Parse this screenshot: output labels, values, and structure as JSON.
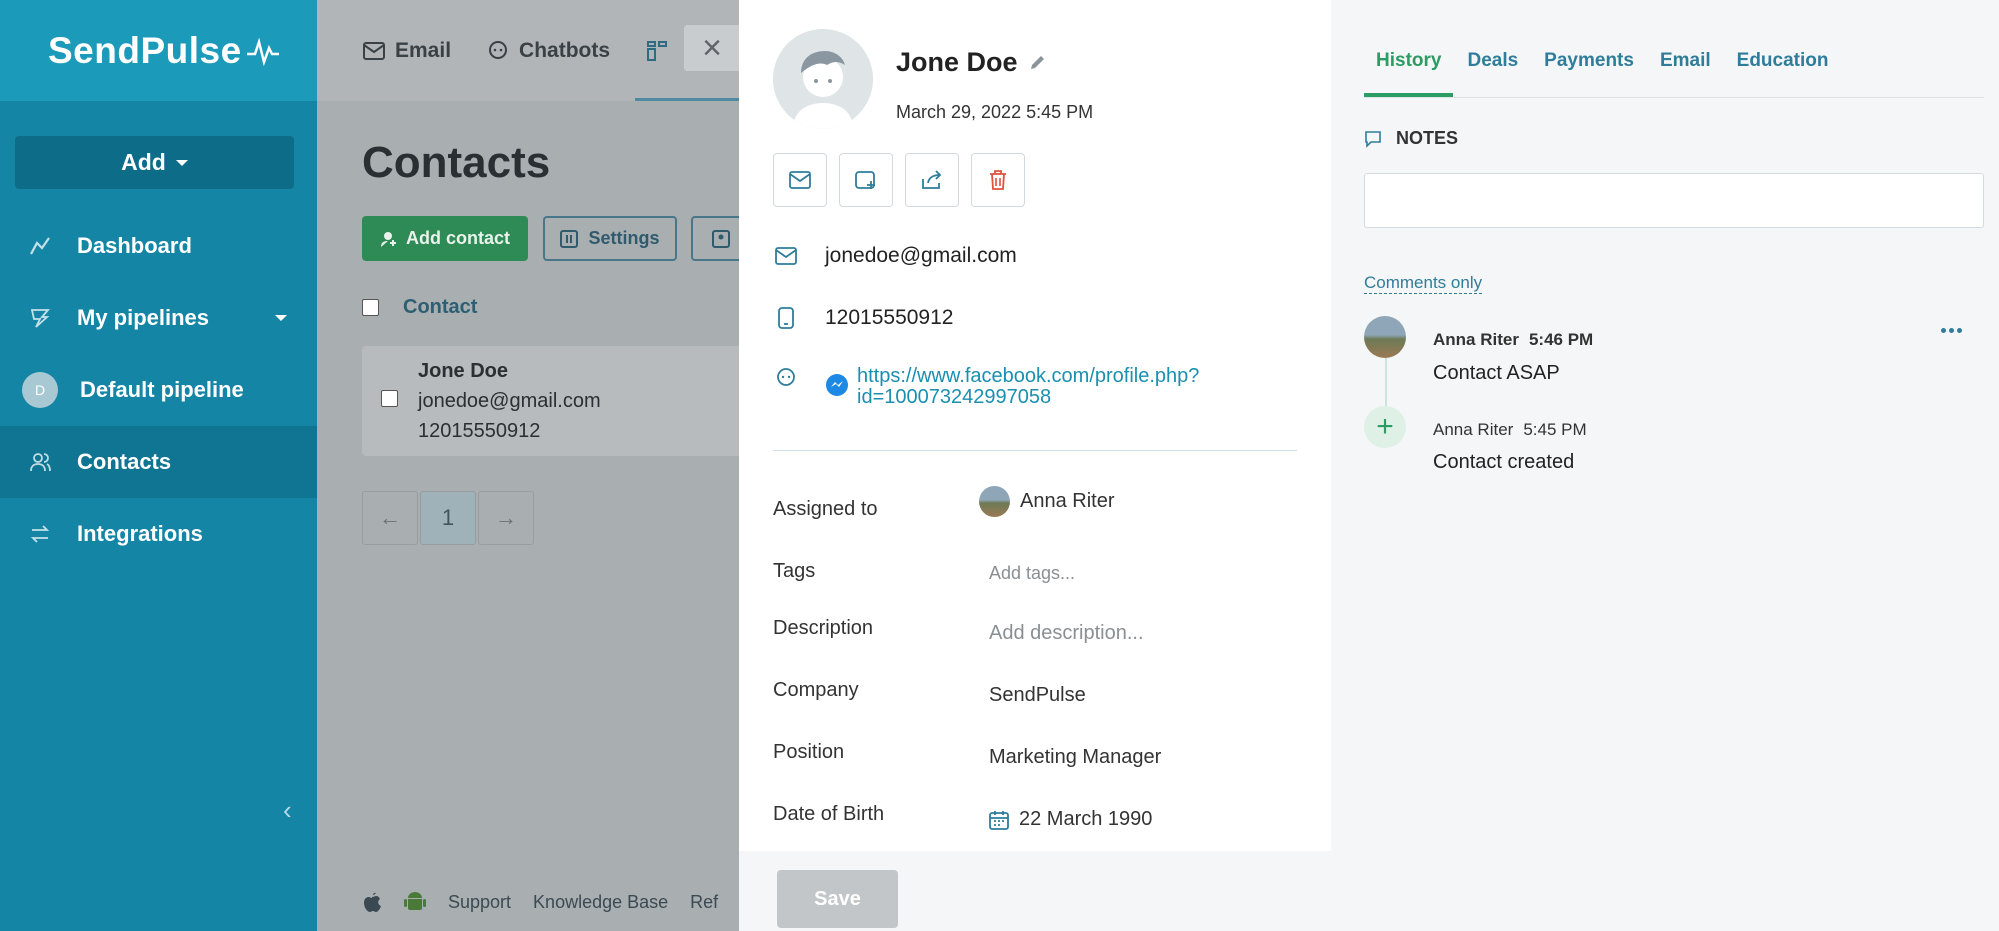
{
  "app": {
    "logo": "SendPulse"
  },
  "sidebar": {
    "add_label": "Add",
    "items": [
      {
        "label": "Dashboard",
        "icon": "chart-line-icon"
      },
      {
        "label": "My pipelines",
        "icon": "filter-icon"
      },
      {
        "label": "Default pipeline",
        "icon": "pipeline-avatar",
        "avatar_letter": "D"
      },
      {
        "label": "Contacts",
        "icon": "contacts-icon",
        "active": true
      },
      {
        "label": "Integrations",
        "icon": "integrations-icon"
      }
    ]
  },
  "topbar": {
    "items": [
      {
        "label": "Email",
        "icon": "envelope-icon"
      },
      {
        "label": "Chatbots",
        "icon": "chat-icon"
      }
    ]
  },
  "contacts_page": {
    "title": "Contacts",
    "add_contact_label": "Add contact",
    "settings_label": "Settings",
    "column_contact": "Contact",
    "row": {
      "name": "Jone Doe",
      "email": "jonedoe@gmail.com",
      "phone": "12015550912"
    },
    "pager": {
      "prev": "←",
      "page": "1",
      "next": "→"
    },
    "footer": {
      "support": "Support",
      "knowledge_base": "Knowledge Base",
      "ref": "Ref"
    }
  },
  "contact": {
    "name": "Jone Doe",
    "created": "March 29, 2022 5:45 PM",
    "email": "jonedoe@gmail.com",
    "phone": "12015550912",
    "messenger_url_line1": "https://www.facebook.com/profile.php?",
    "messenger_url_line2": "id=100073242997058",
    "fields": {
      "assigned_to_label": "Assigned to",
      "assigned_to_value": "Anna Riter",
      "tags_label": "Tags",
      "tags_placeholder": "Add tags...",
      "description_label": "Description",
      "description_placeholder": "Add description...",
      "company_label": "Company",
      "company_value": "SendPulse",
      "position_label": "Position",
      "position_value": "Marketing Manager",
      "dob_label": "Date of Birth",
      "dob_value": "22 March 1990"
    },
    "save_label": "Save"
  },
  "history": {
    "tabs": [
      "History",
      "Deals",
      "Payments",
      "Email",
      "Education"
    ],
    "active_tab": "History",
    "notes_heading": "NOTES",
    "comments_only": "Comments only",
    "entries": [
      {
        "author": "Anna Riter",
        "time": "5:46 PM",
        "text": "Contact ASAP"
      },
      {
        "author": "Anna Riter",
        "time": "5:45 PM",
        "text": "Contact created"
      }
    ]
  },
  "colors": {
    "sidebar": "#1585a6",
    "accent_green": "#2b9c63",
    "link": "#1a8fb0",
    "danger": "#e0523f"
  }
}
